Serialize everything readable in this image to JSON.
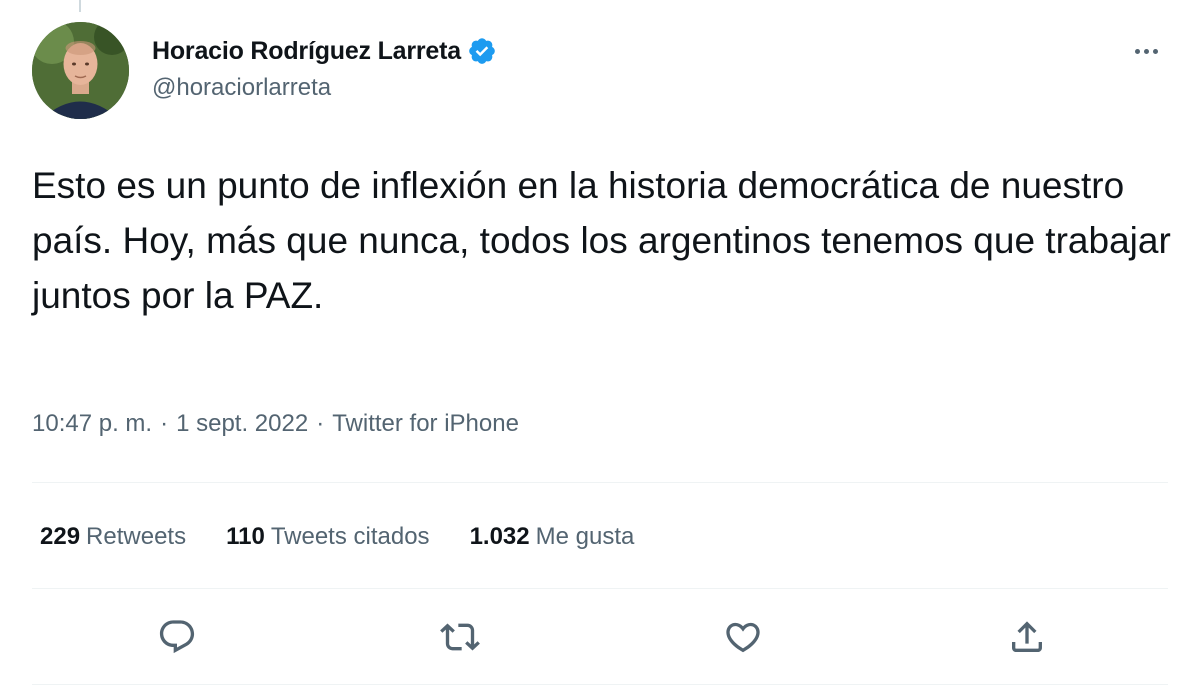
{
  "author": {
    "display_name": "Horacio Rodríguez Larreta",
    "handle": "@horaciorlarreta",
    "verified": true
  },
  "tweet": {
    "text": "Esto es un punto de inflexión en la historia democrática de nuestro país. Hoy, más que nunca, todos los argentinos tenemos que trabajar juntos por la PAZ."
  },
  "meta": {
    "time": "10:47 p. m.",
    "separator": "·",
    "date": "1 sept. 2022",
    "source": "Twitter for iPhone"
  },
  "stats": {
    "retweets": {
      "count": "229",
      "label": "Retweets"
    },
    "quotes": {
      "count": "110",
      "label": "Tweets citados"
    },
    "likes": {
      "count": "1.032",
      "label": "Me gusta"
    }
  },
  "colors": {
    "accent": "#1d9bf0",
    "text_primary": "#0f1419",
    "text_secondary": "#536471",
    "divider": "#eff3f4"
  },
  "icons": {
    "more": "more-horizontal-icon",
    "verified": "verified-badge-icon",
    "reply": "reply-icon",
    "retweet": "retweet-icon",
    "like": "like-icon",
    "share": "share-icon"
  }
}
